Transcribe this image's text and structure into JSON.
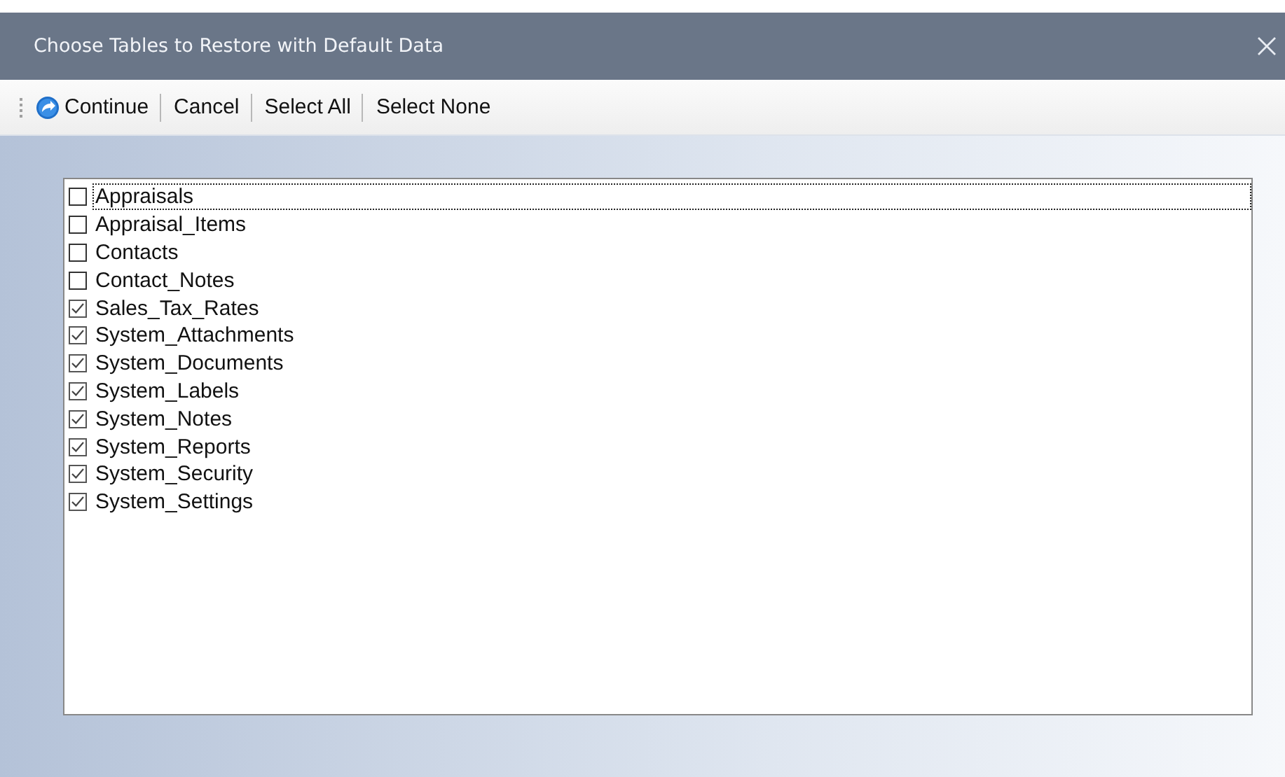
{
  "window": {
    "title": "Choose Tables to Restore with Default Data"
  },
  "toolbar": [
    {
      "label": "Continue",
      "kind": "icon"
    },
    {
      "label": "Cancel",
      "kind": "text"
    },
    {
      "label": "Select All",
      "kind": "text"
    },
    {
      "label": "Select None",
      "kind": "text"
    }
  ],
  "tables": [
    {
      "name": "Appraisals",
      "checked": false,
      "focused": true
    },
    {
      "name": "Appraisal_Items",
      "checked": false,
      "focused": false
    },
    {
      "name": "Contacts",
      "checked": false,
      "focused": false
    },
    {
      "name": "Contact_Notes",
      "checked": false,
      "focused": false
    },
    {
      "name": "Sales_Tax_Rates",
      "checked": true,
      "focused": false
    },
    {
      "name": "System_Attachments",
      "checked": true,
      "focused": false
    },
    {
      "name": "System_Documents",
      "checked": true,
      "focused": false
    },
    {
      "name": "System_Labels",
      "checked": true,
      "focused": false
    },
    {
      "name": "System_Notes",
      "checked": true,
      "focused": false
    },
    {
      "name": "System_Reports",
      "checked": true,
      "focused": false
    },
    {
      "name": "System_Security",
      "checked": true,
      "focused": false
    },
    {
      "name": "System_Settings",
      "checked": true,
      "focused": false
    }
  ]
}
